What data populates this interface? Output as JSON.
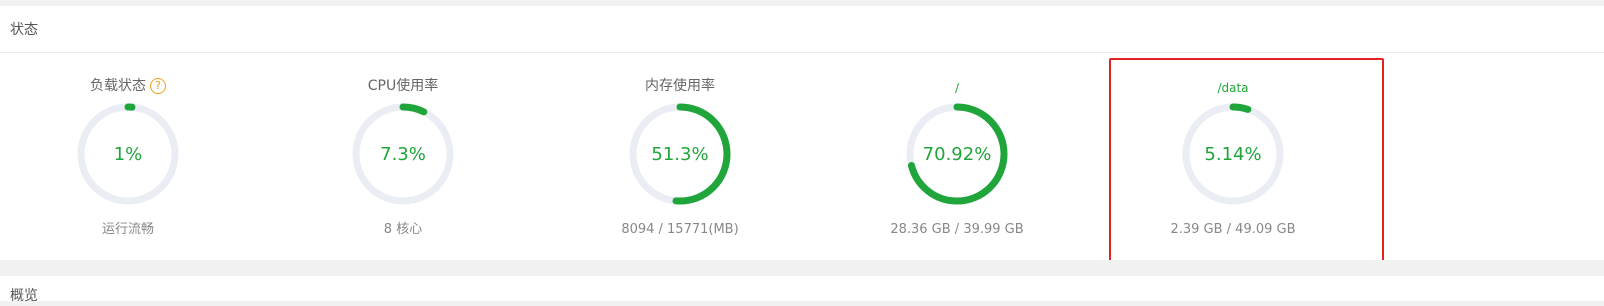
{
  "status_panel": {
    "title": "状态"
  },
  "gauges": [
    {
      "label": "负载状态",
      "value_text": "1%",
      "percent": 1,
      "detail": "运行流畅",
      "has_help": true,
      "help_glyph": "?"
    },
    {
      "label": "CPU使用率",
      "value_text": "7.3%",
      "percent": 7.3,
      "detail": "8 核心",
      "has_help": false
    },
    {
      "label": "内存使用率",
      "value_text": "51.3%",
      "percent": 51.3,
      "detail": "8094 / 15771(MB)",
      "has_help": false
    },
    {
      "label": "/",
      "value_text": "70.92%",
      "percent": 70.92,
      "detail": "28.36 GB / 39.99 GB",
      "has_help": false
    },
    {
      "label": "/data",
      "value_text": "5.14%",
      "percent": 5.14,
      "detail": "2.39 GB / 49.09 GB",
      "has_help": false,
      "highlighted": true
    }
  ],
  "colors": {
    "accent": "#20a53a",
    "track": "#eaedf3",
    "highlight": "#e52222",
    "help": "#f0a020"
  },
  "overview_panel": {
    "title": "概览"
  }
}
